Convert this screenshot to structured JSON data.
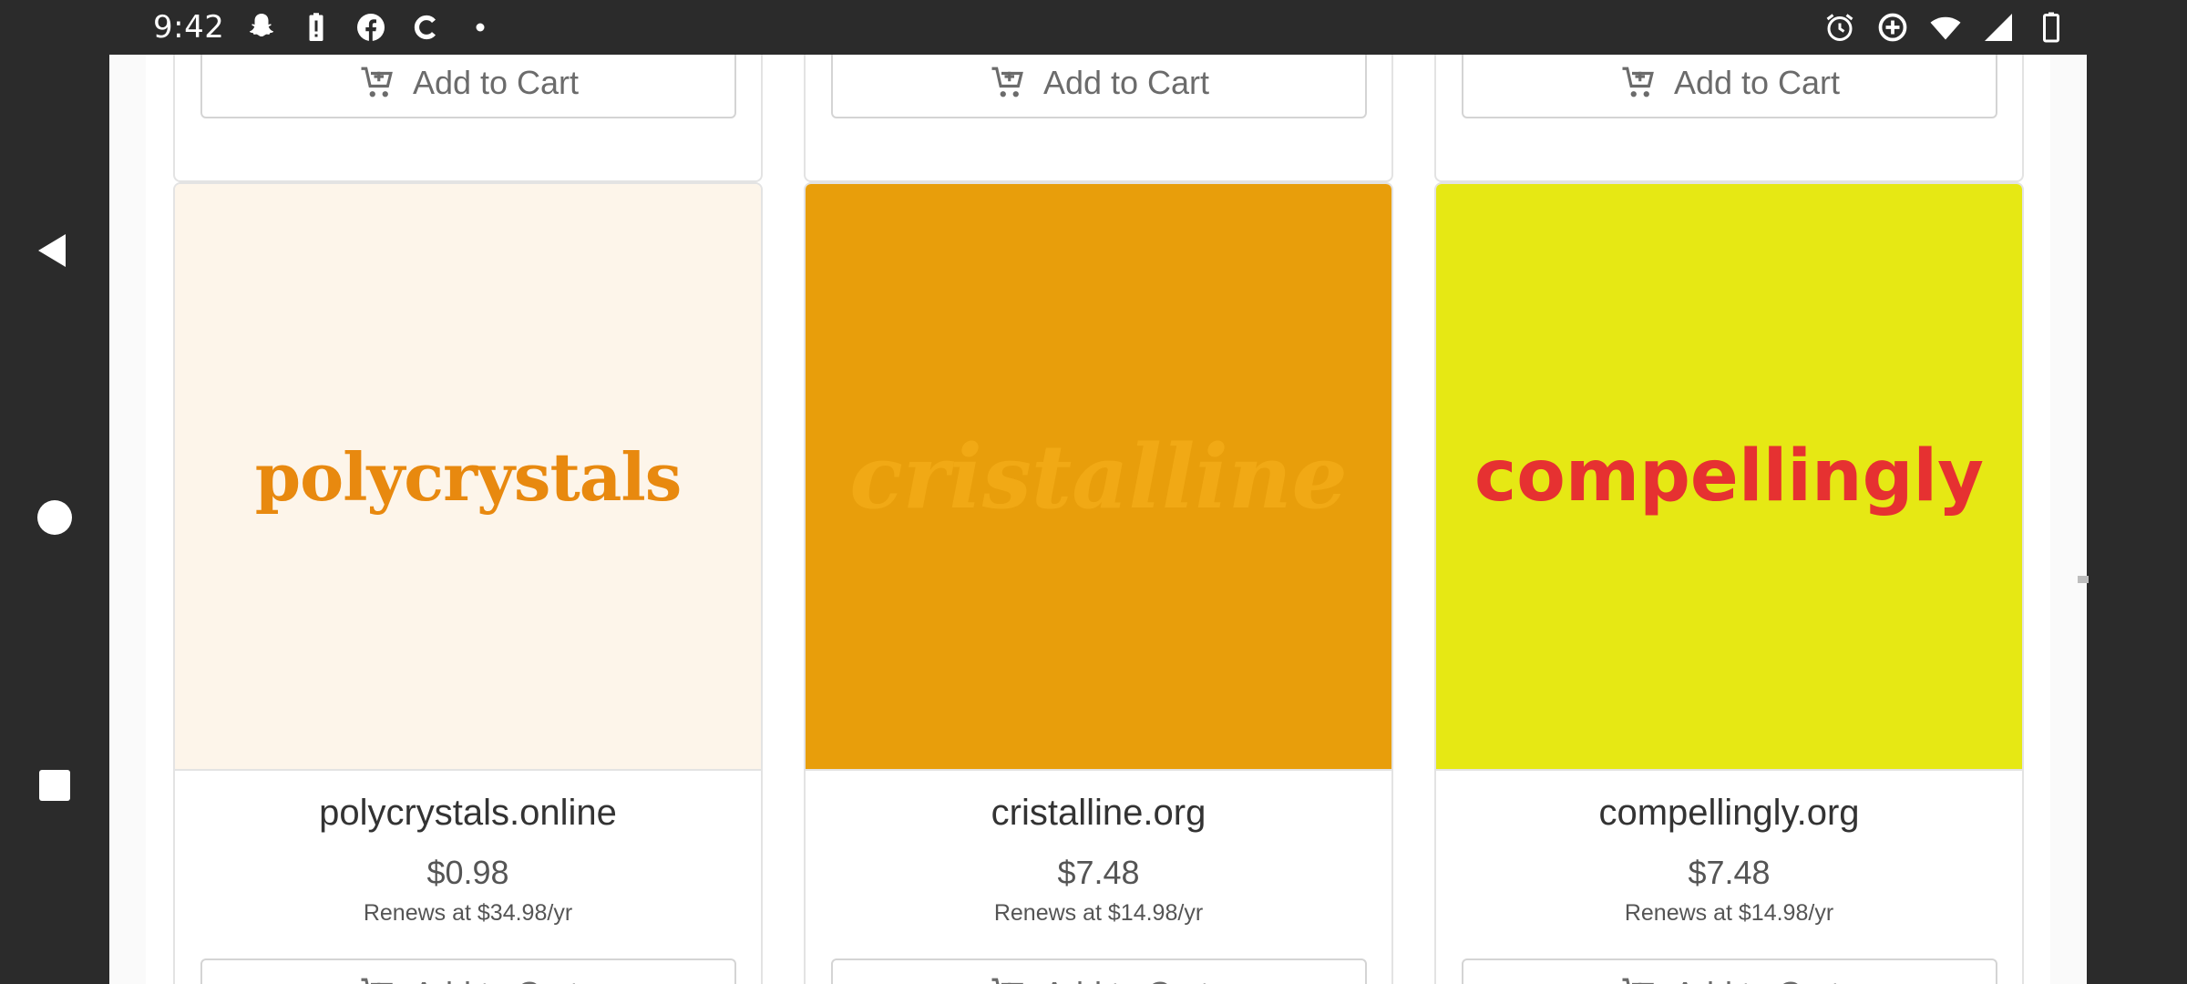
{
  "status_bar": {
    "time": "9:42",
    "left_icons": [
      "snapchat-icon",
      "battery-alert-icon",
      "facebook-icon",
      "c-app-icon",
      "dot-icon"
    ],
    "right_icons": [
      "alarm-icon",
      "data-saver-icon",
      "wifi-icon",
      "cell-signal-icon",
      "battery-icon"
    ]
  },
  "nav_bar": {
    "buttons": [
      "back-icon",
      "home-icon",
      "recents-icon"
    ]
  },
  "top_row": {
    "cart_label": "Add to Cart"
  },
  "products": [
    {
      "logo_text": "polycrystals",
      "logo_color": "#e8890f",
      "bg_color": "#fdf5ea",
      "name": "polycrystals.online",
      "price": "$0.98",
      "renew": "Renews at $34.98/yr",
      "cart_label": "Add to Cart"
    },
    {
      "logo_text": "cristalline",
      "logo_color": "#f1a915",
      "bg_color": "#e89e0b",
      "name": "cristalline.org",
      "price": "$7.48",
      "renew": "Renews at $14.98/yr",
      "cart_label": "Add to Cart"
    },
    {
      "logo_text": "compellingly",
      "logo_color": "#e63131",
      "bg_color": "#e6e814",
      "name": "compellingly.org",
      "price": "$7.48",
      "renew": "Renews at $14.98/yr",
      "cart_label": "Add to Cart"
    }
  ]
}
